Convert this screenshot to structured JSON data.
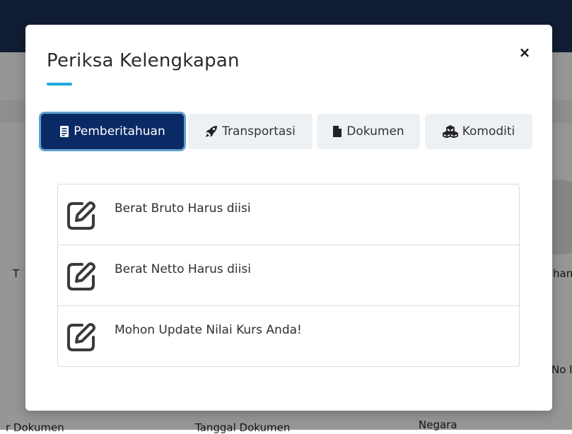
{
  "background": {
    "labels": [
      "T",
      "han",
      "No I",
      "r Dokumen",
      "Tanggal Dokumen",
      "Negara"
    ]
  },
  "modal": {
    "title": "Periksa Kelengkapan",
    "close_label": "×",
    "tabs": [
      {
        "label": "Pemberitahuan",
        "icon": "clipboard-icon",
        "active": true
      },
      {
        "label": "Transportasi",
        "icon": "rocket-icon",
        "active": false
      },
      {
        "label": "Dokumen",
        "icon": "file-icon",
        "active": false
      },
      {
        "label": "Komoditi",
        "icon": "cubes-icon",
        "active": false
      }
    ],
    "items": [
      {
        "text": "Berat Bruto Harus diisi",
        "icon": "edit-icon"
      },
      {
        "text": "Berat Netto Harus diisi",
        "icon": "edit-icon"
      },
      {
        "text": "Mohon Update Nilai Kurs Anda!",
        "icon": "edit-icon"
      }
    ]
  },
  "colors": {
    "active_tab": "#0a2a66",
    "active_tab_ring": "#5fa3c9",
    "inactive_tab": "#eef1f4",
    "title_accent": "#1ea7e1",
    "top_bar": "#1c2f55"
  }
}
